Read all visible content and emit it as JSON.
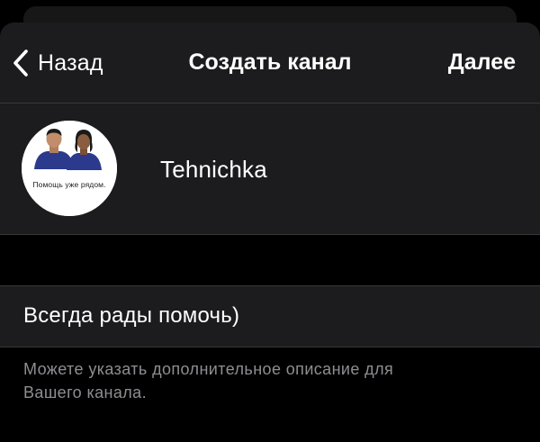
{
  "navbar": {
    "back_label": "Назад",
    "title": "Создать канал",
    "next_label": "Далее"
  },
  "profile": {
    "avatar_caption": "Помощь уже рядом.",
    "channel_name": "Tehnichka"
  },
  "description": {
    "value": "Всегда рады помочь)"
  },
  "hint": {
    "line1": "Можете указать дополнительное описание для",
    "line2": "Вашего канала."
  },
  "colors": {
    "background": "#000000",
    "cell_background": "#1c1c1e",
    "separator": "#38383a",
    "secondary_text": "#8e8e93",
    "shirt_blue": "#2b3a8c"
  },
  "icons": {
    "back": "chevron-left-icon"
  }
}
